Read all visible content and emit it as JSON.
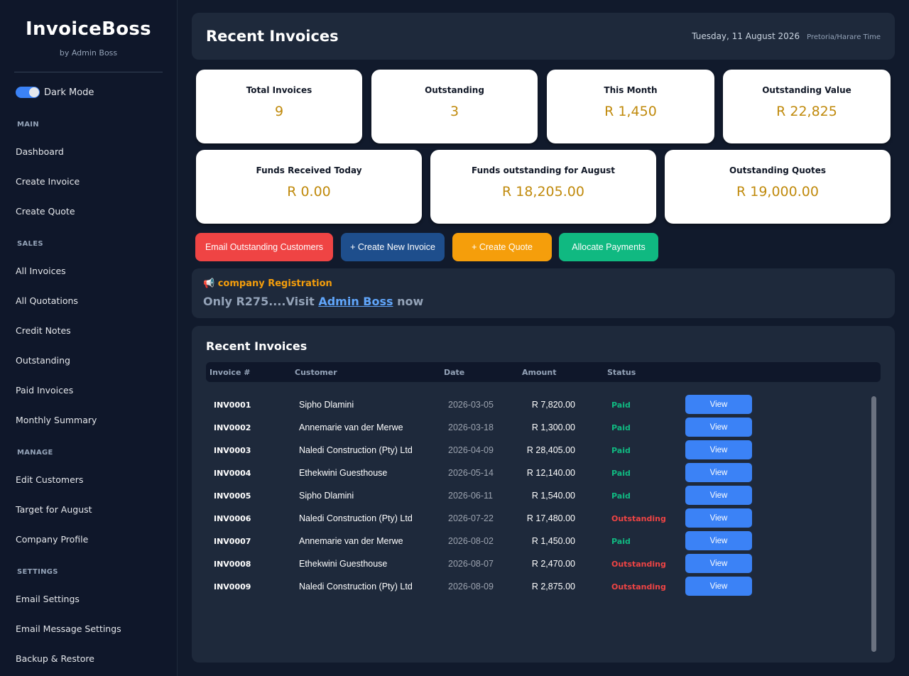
{
  "sidebar": {
    "brand": "InvoiceBoss",
    "byline": "by Admin Boss",
    "dark_mode_label": "Dark Mode",
    "sections": [
      {
        "label": "MAIN",
        "items": [
          "Dashboard",
          "Create Invoice",
          "Create Quote"
        ]
      },
      {
        "label": "SALES",
        "items": [
          "All Invoices",
          "All Quotations",
          "Credit Notes",
          "Outstanding",
          "Paid Invoices",
          "Monthly Summary"
        ]
      },
      {
        "label": "MANAGE",
        "items": [
          "Edit Customers",
          "Target for August",
          "Company Profile"
        ]
      },
      {
        "label": "SETTINGS",
        "items": [
          "Email Settings",
          "Email Message Settings",
          "Backup & Restore"
        ]
      }
    ]
  },
  "header": {
    "title": "Recent Invoices",
    "date": "Tuesday, 11 August 2026",
    "timezone": "Pretoria/Harare Time"
  },
  "stats": [
    {
      "label": "Total Invoices",
      "value": "9"
    },
    {
      "label": "Outstanding",
      "value": "3"
    },
    {
      "label": "This Month",
      "value": "R 1,450"
    },
    {
      "label": "Outstanding Value",
      "value": "R 22,825"
    },
    {
      "label": "Funds Received Today",
      "value": "R 0.00"
    },
    {
      "label": "Funds outstanding for August",
      "value": "R 18,205.00"
    },
    {
      "label": "Outstanding Quotes",
      "value": "R 19,000.00"
    }
  ],
  "actions": {
    "email": "Email Outstanding Customers",
    "create_invoice": "+ Create New Invoice",
    "create_quote": "+ Create Quote",
    "allocate": "Allocate Payments"
  },
  "colors": {
    "email": "#ef4444",
    "create_invoice": "#1e4e8c",
    "create_quote": "#f59e0b",
    "allocate": "#10b981",
    "paid": "#10b981",
    "outstanding": "#ef4444"
  },
  "promo": {
    "icon": "megaphone-icon",
    "title": "company Registration",
    "text_before": "Only R275....Visit ",
    "link": "Admin Boss",
    "text_after": " now"
  },
  "table": {
    "title": "Recent Invoices",
    "headers": [
      "Invoice #",
      "Customer",
      "Date",
      "Amount",
      "Status"
    ],
    "view_label": "View",
    "rows": [
      {
        "num": "INV0001",
        "customer": "Sipho Dlamini",
        "date": "2026-03-05",
        "amount": "R 7,820.00",
        "status": "Paid"
      },
      {
        "num": "INV0002",
        "customer": "Annemarie van der Merwe",
        "date": "2026-03-18",
        "amount": "R 1,300.00",
        "status": "Paid"
      },
      {
        "num": "INV0003",
        "customer": "Naledi Construction (Pty) Ltd",
        "date": "2026-04-09",
        "amount": "R 28,405.00",
        "status": "Paid"
      },
      {
        "num": "INV0004",
        "customer": "Ethekwini Guesthouse",
        "date": "2026-05-14",
        "amount": "R 12,140.00",
        "status": "Paid"
      },
      {
        "num": "INV0005",
        "customer": "Sipho Dlamini",
        "date": "2026-06-11",
        "amount": "R 1,540.00",
        "status": "Paid"
      },
      {
        "num": "INV0006",
        "customer": "Naledi Construction (Pty) Ltd",
        "date": "2026-07-22",
        "amount": "R 17,480.00",
        "status": "Outstanding"
      },
      {
        "num": "INV0007",
        "customer": "Annemarie van der Merwe",
        "date": "2026-08-02",
        "amount": "R 1,450.00",
        "status": "Paid"
      },
      {
        "num": "INV0008",
        "customer": "Ethekwini Guesthouse",
        "date": "2026-08-07",
        "amount": "R 2,470.00",
        "status": "Outstanding"
      },
      {
        "num": "INV0009",
        "customer": "Naledi Construction (Pty) Ltd",
        "date": "2026-08-09",
        "amount": "R 2,875.00",
        "status": "Outstanding"
      }
    ]
  }
}
